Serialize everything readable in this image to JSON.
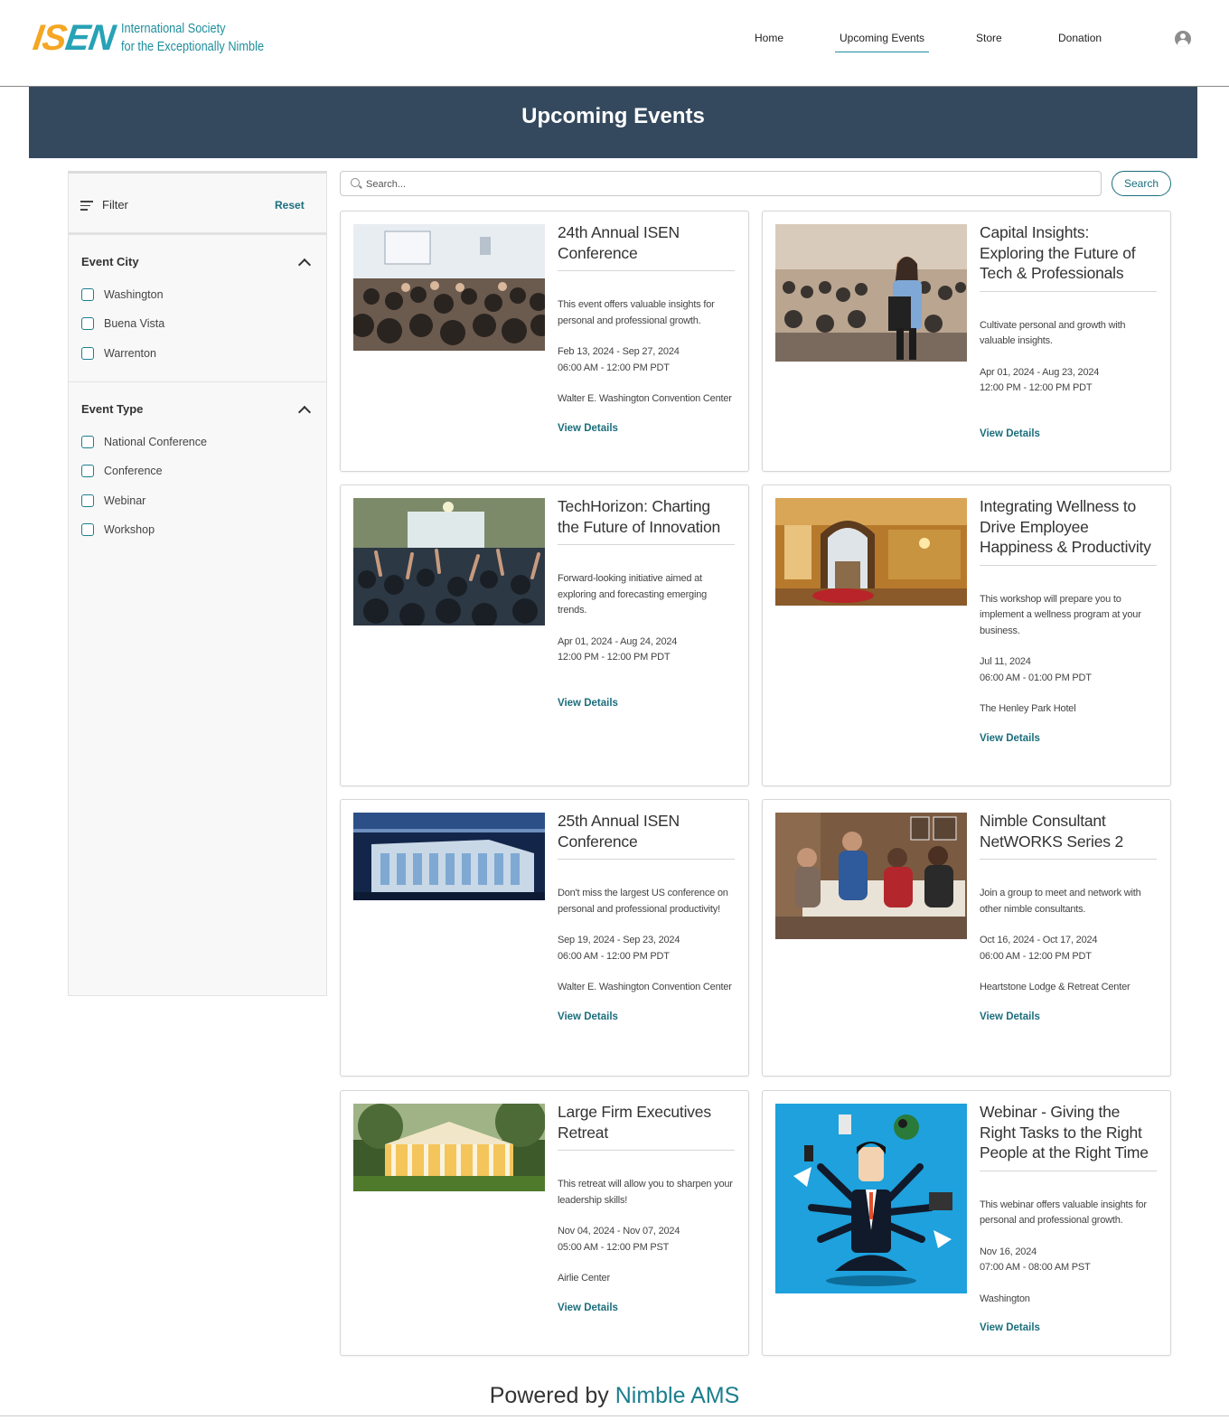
{
  "header": {
    "logo_mark": [
      "I",
      "S",
      "E",
      "N"
    ],
    "logo_line1": "International Society",
    "logo_line2": "for the Exceptionally Nimble",
    "nav": [
      {
        "label": "Home"
      },
      {
        "label": "Upcoming Events",
        "active": true
      },
      {
        "label": "Store"
      },
      {
        "label": "Donation"
      }
    ],
    "avatar_icon": "user-icon"
  },
  "banner": {
    "title": "Upcoming Events"
  },
  "sidebar": {
    "filter_label": "Filter",
    "reset_label": "Reset",
    "facets": [
      {
        "title": "Event City",
        "options": [
          "Washington",
          "Buena Vista",
          "Warrenton"
        ]
      },
      {
        "title": "Event Type",
        "options": [
          "National Conference",
          "Conference",
          "Webinar",
          "Workshop"
        ]
      }
    ]
  },
  "search": {
    "placeholder": "Search...",
    "value": "",
    "button_label": "Search"
  },
  "events": [
    {
      "title": "24th Annual ISEN Conference",
      "description": "This event offers valuable insights for personal and professional growth.",
      "date_line": "Feb 13, 2024 - Sep 27, 2024",
      "time_line": "06:00 AM - 12:00 PM PDT",
      "venue": "Walter E. Washington Convention Center",
      "link": "View Details",
      "image": "conference-audience-photo"
    },
    {
      "title": "Capital Insights: Exploring the Future of Tech & Professionals",
      "description": "Cultivate personal and growth with valuable insights.",
      "date_line": "Apr 01, 2024 - Aug 23, 2024",
      "time_line": "12:00 PM - 12:00 PM PDT",
      "venue": "",
      "link": "View Details",
      "image": "speaker-with-microphone-photo"
    },
    {
      "title": "TechHorizon: Charting the Future of Innovation",
      "description": "Forward-looking initiative aimed at exploring and forecasting emerging trends.",
      "date_line": "Apr 01, 2024 - Aug 24, 2024",
      "time_line": "12:00 PM - 12:00 PM PDT",
      "venue": "",
      "link": "View Details",
      "image": "raised-hands-audience-photo"
    },
    {
      "title": "Integrating Wellness to Drive Employee Happiness & Productivity",
      "description": "This workshop will prepare you to implement a wellness program at your business.",
      "date_line": "Jul 11, 2024",
      "time_line": "06:00 AM - 01:00 PM PDT",
      "venue": "The Henley Park Hotel",
      "link": "View Details",
      "image": "hotel-lobby-photo"
    },
    {
      "title": "25th Annual ISEN Conference",
      "description": "Don't miss the largest US conference on personal and professional productivity!",
      "date_line": "Sep 19, 2024 - Sep 23, 2024",
      "time_line": "06:00 AM - 12:00 PM PDT",
      "venue": "Walter E. Washington Convention Center",
      "link": "View Details",
      "image": "convention-center-night-photo"
    },
    {
      "title": "Nimble Consultant NetWORKS Series 2",
      "description": "Join a group to meet and network with other nimble consultants.",
      "date_line": "Oct 16, 2024 - Oct 17, 2024",
      "time_line": "06:00 AM - 12:00 PM PDT",
      "venue": "Heartstone Lodge & Retreat Center",
      "link": "View Details",
      "image": "group-on-sofa-photo"
    },
    {
      "title": "Large Firm Executives Retreat",
      "description": "This retreat will allow you to sharpen your leadership skills!",
      "date_line": "Nov 04, 2024 - Nov 07, 2024",
      "time_line": "05:00 AM - 12:00 PM PST",
      "venue": "Airlie Center",
      "link": "View Details",
      "image": "retreat-building-photo"
    },
    {
      "title": "Webinar - Giving the Right Tasks to the Right People at the Right Time",
      "description": "This webinar offers valuable insights for personal and professional growth.",
      "date_line": "Nov 16, 2024",
      "time_line": "07:00 AM - 08:00 AM PST",
      "venue": "Washington",
      "link": "View Details",
      "image": "multitasking-businessman-illustration"
    }
  ],
  "footer": {
    "prefix": "Powered by",
    "brand": "Nimble AMS"
  },
  "colors": {
    "accent": "#1b6e7d",
    "banner": "#34495e",
    "logo_orange": "#f5a623",
    "logo_teal": "#27a2b6"
  }
}
